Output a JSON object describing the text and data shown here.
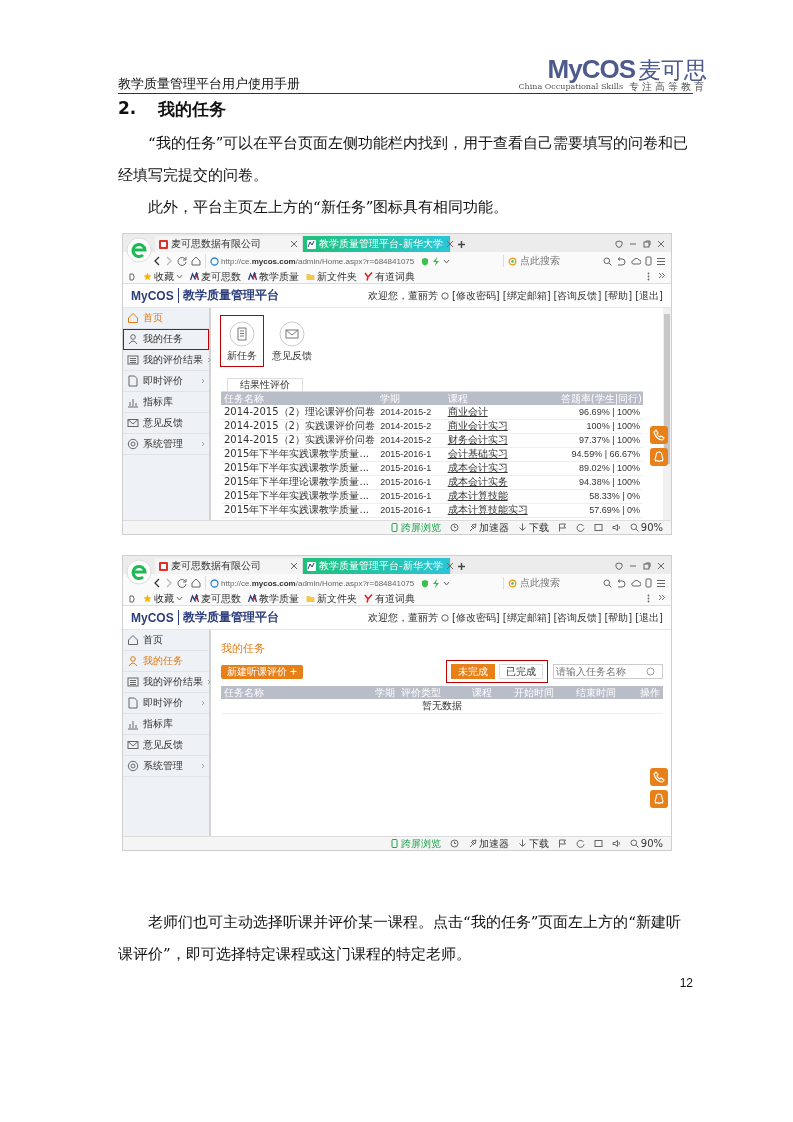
{
  "header": {
    "title": "教学质量管理平台用户使用手册",
    "logo": "MyCOS",
    "logo_cn": "麦可思",
    "tagline_en": "China Occupational Skills",
    "tagline_cn": "专注高等教育"
  },
  "section": {
    "number": "2.",
    "title": "我的任务"
  },
  "paragraphs_before": [
    "“我的任务”可以在平台页面左侧功能栏内找到，用于查看自己需要填写的问卷和已经填写完提交的问卷。",
    "此外，平台主页左上方的“新任务”图标具有相同功能。"
  ],
  "screenshots": [
    {
      "browser": {
        "tabs": [
          {
            "label": "麦可思数据有限公司",
            "selected": false
          },
          {
            "label": "教学质量管理平台-新华大学",
            "selected": true
          }
        ],
        "url": "http://ce.**mycos.com**/admin/Home.aspx?r=684841075",
        "search_placeholder": "点此搜索",
        "bookmarks": [
          {
            "label": "收藏",
            "kind": "favorites"
          },
          {
            "label": "麦可思数",
            "kind": "site"
          },
          {
            "label": "教学质量",
            "kind": "site"
          },
          {
            "label": "新文件夹",
            "kind": "folder"
          },
          {
            "label": "有道词典",
            "kind": "dict"
          }
        ]
      },
      "app": {
        "logo": "MyCOS",
        "title": "教学质量管理平台",
        "welcome": "欢迎您，董丽芳",
        "links": [
          "[修改密码]",
          "[绑定邮箱]",
          "[咨询反馈]",
          "[帮助]",
          "[退出]"
        ]
      },
      "sidebar": [
        {
          "label": "首页",
          "selected": true,
          "submenu": false,
          "highlighted": false
        },
        {
          "label": "我的任务",
          "selected": false,
          "submenu": false,
          "highlighted": true
        },
        {
          "label": "我的评价结果",
          "selected": false,
          "submenu": true,
          "highlighted": false
        },
        {
          "label": "即时评价",
          "selected": false,
          "submenu": true,
          "highlighted": false
        },
        {
          "label": "指标库",
          "selected": false,
          "submenu": false,
          "highlighted": false
        },
        {
          "label": "意见反馈",
          "selected": false,
          "submenu": false,
          "highlighted": false
        },
        {
          "label": "系统管理",
          "selected": false,
          "submenu": true,
          "highlighted": false
        }
      ],
      "content": {
        "kind": "home",
        "tiles": [
          {
            "label": "新任务",
            "highlighted": true
          },
          {
            "label": "意见反馈",
            "highlighted": false
          }
        ],
        "panel_tab": "结果性评价",
        "columns": [
          "任务名称",
          "学期",
          "课程",
          "答题率(学生|同行)"
        ],
        "rows": [
          {
            "name": "2014-2015（2）理论课评价问卷",
            "term": "2014-2015-2",
            "course": "商业会计",
            "rate": "96.69% | 100%"
          },
          {
            "name": "2014-2015（2）实践课评价问卷",
            "term": "2014-2015-2",
            "course": "商业会计实习",
            "rate": "100% | 100%"
          },
          {
            "name": "2014-2015（2）实践课评价问卷",
            "term": "2014-2015-2",
            "course": "财务会计实习",
            "rate": "97.37% | 100%"
          },
          {
            "name": "2015年下半年实践课教学质量...",
            "term": "2015-2016-1",
            "course": "会计基础实习",
            "rate": "94.59% | 66.67%"
          },
          {
            "name": "2015年下半年实践课教学质量...",
            "term": "2015-2016-1",
            "course": "成本会计实习",
            "rate": "89.02% | 100%"
          },
          {
            "name": "2015年下半年理论课教学质量...",
            "term": "2015-2016-1",
            "course": "成本会计实务",
            "rate": "94.38% | 100%"
          },
          {
            "name": "2015年下半年实践课教学质量...",
            "term": "2015-2016-1",
            "course": "成本计算技能",
            "rate": "58.33% | 0%"
          },
          {
            "name": "2015年下半年实践课教学质量...",
            "term": "2015-2016-1",
            "course": "成本计算技能实习",
            "rate": "57.69% | 0%"
          }
        ]
      },
      "status_bar": {
        "items": [
          {
            "label": "跨屏浏览",
            "kind": "cross-screen"
          },
          {
            "label": "加速器",
            "kind": "accelerator"
          },
          {
            "label": "下载",
            "kind": "download"
          }
        ],
        "zoom": "90%"
      }
    },
    {
      "browser": {
        "tabs": [
          {
            "label": "麦可思数据有限公司",
            "selected": false
          },
          {
            "label": "教学质量管理平台-新华大学",
            "selected": true
          }
        ],
        "url": "http://ce.**mycos.com**/admin/Home.aspx?r=684841075",
        "search_placeholder": "点此搜索",
        "bookmarks": [
          {
            "label": "收藏",
            "kind": "favorites"
          },
          {
            "label": "麦可思数",
            "kind": "site"
          },
          {
            "label": "教学质量",
            "kind": "site"
          },
          {
            "label": "新文件夹",
            "kind": "folder"
          },
          {
            "label": "有道词典",
            "kind": "dict"
          }
        ]
      },
      "app": {
        "logo": "MyCOS",
        "title": "教学质量管理平台",
        "welcome": "欢迎您，董丽芳",
        "links": [
          "[修改密码]",
          "[绑定邮箱]",
          "[咨询反馈]",
          "[帮助]",
          "[退出]"
        ]
      },
      "sidebar": [
        {
          "label": "首页",
          "selected": false,
          "submenu": false,
          "highlighted": false
        },
        {
          "label": "我的任务",
          "selected": true,
          "submenu": false,
          "highlighted": false
        },
        {
          "label": "我的评价结果",
          "selected": false,
          "submenu": true,
          "highlighted": false
        },
        {
          "label": "即时评价",
          "selected": false,
          "submenu": true,
          "highlighted": false
        },
        {
          "label": "指标库",
          "selected": false,
          "submenu": false,
          "highlighted": false
        },
        {
          "label": "意见反馈",
          "selected": false,
          "submenu": false,
          "highlighted": false
        },
        {
          "label": "系统管理",
          "selected": false,
          "submenu": true,
          "highlighted": false
        }
      ],
      "content": {
        "kind": "tasks",
        "title": "我的任务",
        "new_button": "新建听课评价",
        "filters": [
          {
            "label": "未完成",
            "selected": true
          },
          {
            "label": "已完成",
            "selected": false
          }
        ],
        "filters_highlighted": true,
        "search_placeholder": "请输入任务名称",
        "columns": [
          "任务名称",
          "学期",
          "评价类型",
          "课程",
          "开始时间",
          "结束时间",
          "操作"
        ],
        "empty_text": "暂无数据"
      },
      "status_bar": {
        "items": [
          {
            "label": "跨屏浏览",
            "kind": "cross-screen"
          },
          {
            "label": "加速器",
            "kind": "accelerator"
          },
          {
            "label": "下载",
            "kind": "download"
          }
        ],
        "zoom": "90%"
      }
    }
  ],
  "paragraphs_after": [
    "老师们也可主动选择听课并评价某一课程。点击“我的任务”页面左上方的“新建听课评价”，即可选择特定课程或这门课程的特定老师。"
  ],
  "page_number": "12"
}
